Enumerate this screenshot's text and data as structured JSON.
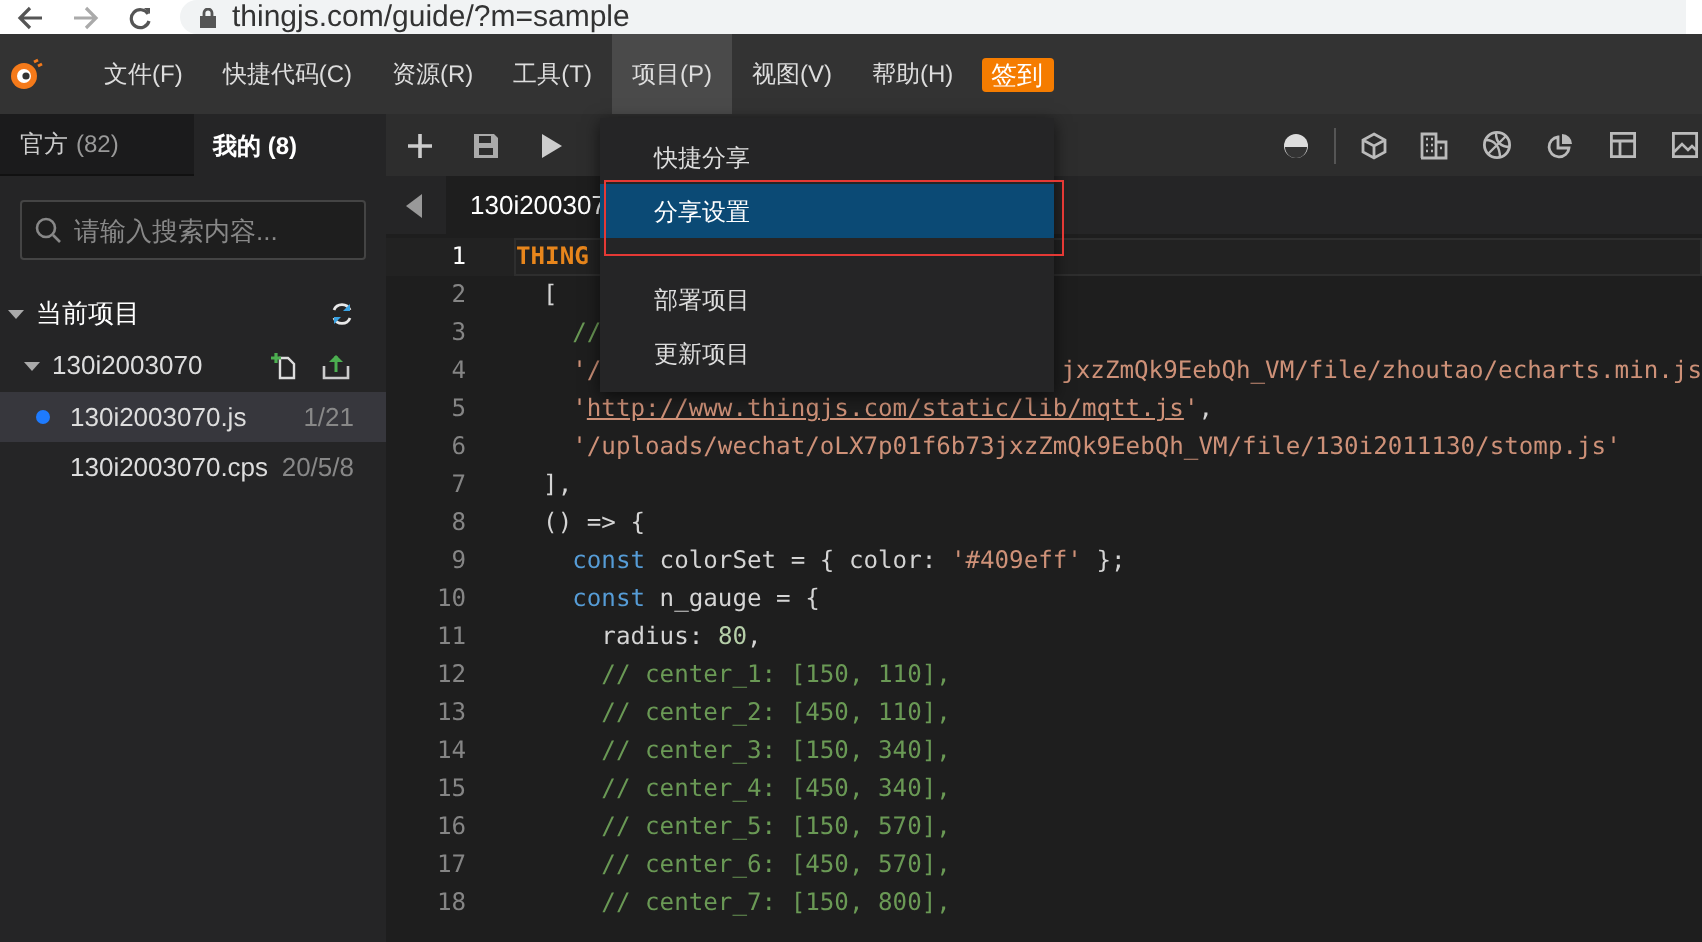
{
  "browser": {
    "url": "thingjs.com/guide/?m=sample"
  },
  "menu_bar": {
    "items": [
      {
        "label": "文件(F)",
        "selected": false
      },
      {
        "label": "快捷代码(C)",
        "selected": false
      },
      {
        "label": "资源(R)",
        "selected": false
      },
      {
        "label": "工具(T)",
        "selected": false
      },
      {
        "label": "项目(P)",
        "selected": true
      },
      {
        "label": "视图(V)",
        "selected": false
      },
      {
        "label": "帮助(H)",
        "selected": false
      }
    ],
    "sign_in": "签到"
  },
  "dropdown": {
    "items": [
      {
        "kind": "item",
        "label": "快捷分享",
        "selected": false
      },
      {
        "kind": "item",
        "label": "分享设置",
        "selected": true
      },
      {
        "kind": "divider"
      },
      {
        "kind": "item",
        "label": "部署项目",
        "selected": false
      },
      {
        "kind": "item",
        "label": "更新项目",
        "selected": false
      }
    ]
  },
  "sidebar": {
    "tabs": [
      {
        "label": "官方",
        "count": "(82)",
        "selected": false
      },
      {
        "label": "我的 (8)",
        "selected": true
      }
    ],
    "search": {
      "placeholder": "请输入搜索内容..."
    },
    "tree": [
      {
        "label": "当前项目",
        "expanded": true,
        "children": [
          {
            "label": "130i2003070",
            "expanded": true,
            "children": [
              {
                "label": "130i2003070.js",
                "meta": "1/21",
                "modified": true,
                "selected": true
              },
              {
                "label": "130i2003070.cps",
                "meta": "20/5/8",
                "modified": false,
                "selected": false
              }
            ]
          }
        ]
      }
    ]
  },
  "editor": {
    "tabs": [
      {
        "label": "130i200307",
        "selected": true
      }
    ],
    "lines": [
      {
        "number": "1",
        "current": true,
        "tokens": [
          {
            "kind": "constant",
            "text": "THING"
          }
        ]
      },
      {
        "number": "2",
        "tokens": [
          {
            "kind": "plain",
            "text": "  ["
          }
        ]
      },
      {
        "number": "3",
        "tokens": [
          {
            "kind": "comment",
            "text": "    //"
          }
        ]
      },
      {
        "number": "4",
        "kind": "split",
        "tokens": [
          {
            "kind": "string",
            "text": "    '/"
          },
          {
            "kind": "string",
            "text": "jxzZmQk9EebQh_VM/file/zhoutao/echarts.min.js"
          }
        ]
      },
      {
        "number": "5",
        "tokens": [
          {
            "kind": "string",
            "text": "    '"
          },
          {
            "kind": "link",
            "text": "http://www.thingjs.com/static/lib/mqtt.js"
          },
          {
            "kind": "string",
            "text": "'"
          },
          {
            "kind": "plain",
            "text": ","
          }
        ]
      },
      {
        "number": "6",
        "tokens": [
          {
            "kind": "string",
            "text": "    '/uploads/wechat/oLX7p01f6b73jxzZmQk9EebQh_VM/file/130i2011130/stomp.js'"
          }
        ]
      },
      {
        "number": "7",
        "tokens": [
          {
            "kind": "plain",
            "text": "  ],"
          }
        ]
      },
      {
        "number": "8",
        "tokens": [
          {
            "kind": "plain",
            "text": "  () => {"
          }
        ]
      },
      {
        "number": "9",
        "tokens": [
          {
            "kind": "keyword",
            "text": "    const"
          },
          {
            "kind": "plain",
            "text": " colorSet = { color: "
          },
          {
            "kind": "string",
            "text": "'#409eff'"
          },
          {
            "kind": "plain",
            "text": " };"
          }
        ]
      },
      {
        "number": "10",
        "tokens": [
          {
            "kind": "keyword",
            "text": "    const"
          },
          {
            "kind": "plain",
            "text": " n_gauge = {"
          }
        ]
      },
      {
        "number": "11",
        "tokens": [
          {
            "kind": "plain",
            "text": "      radius: "
          },
          {
            "kind": "number",
            "text": "80"
          },
          {
            "kind": "plain",
            "text": ","
          }
        ]
      },
      {
        "number": "12",
        "tokens": [
          {
            "kind": "comment",
            "text": "      // center_1: [150, 110],"
          }
        ]
      },
      {
        "number": "13",
        "tokens": [
          {
            "kind": "comment",
            "text": "      // center_2: [450, 110],"
          }
        ]
      },
      {
        "number": "14",
        "tokens": [
          {
            "kind": "comment",
            "text": "      // center_3: [150, 340],"
          }
        ]
      },
      {
        "number": "15",
        "tokens": [
          {
            "kind": "comment",
            "text": "      // center_4: [450, 340],"
          }
        ]
      },
      {
        "number": "16",
        "tokens": [
          {
            "kind": "comment",
            "text": "      // center_5: [150, 570],"
          }
        ]
      },
      {
        "number": "17",
        "tokens": [
          {
            "kind": "comment",
            "text": "      // center_6: [450, 570],"
          }
        ]
      },
      {
        "number": "18",
        "tokens": [
          {
            "kind": "comment",
            "text": "      // center_7: [150, 800],"
          }
        ]
      }
    ]
  }
}
